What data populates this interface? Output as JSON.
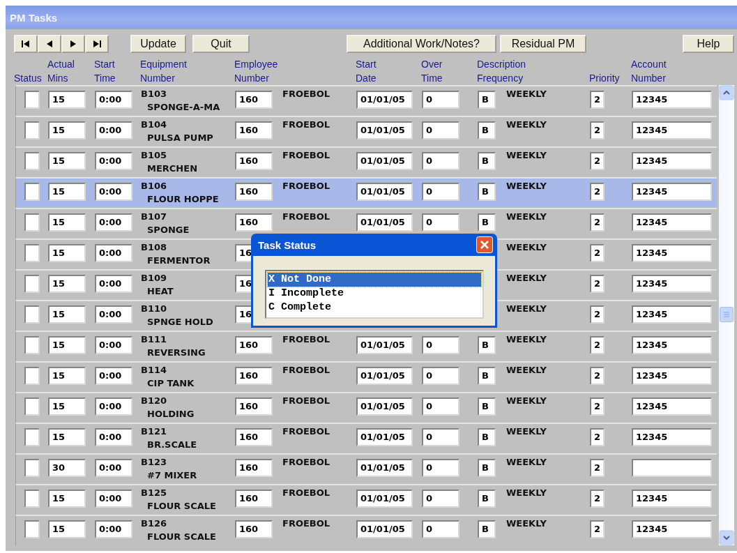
{
  "window": {
    "title": "PM Tasks"
  },
  "toolbar": {
    "nav": [
      {
        "kind": "first"
      },
      {
        "kind": "previous"
      },
      {
        "kind": "next"
      },
      {
        "kind": "last"
      }
    ],
    "actions": [
      "Update",
      "Quit"
    ],
    "notes_buttons": [
      "Additional Work/Notes?",
      "Residual PM"
    ],
    "help": "Help"
  },
  "columns": [
    {
      "lines": [
        "Status"
      ]
    },
    {
      "lines": [
        "Actual",
        "Mins"
      ]
    },
    {
      "lines": [
        "Start",
        "Time"
      ]
    },
    {
      "lines": [
        "Equipment",
        "Number"
      ]
    },
    {
      "lines": [
        "Employee",
        "Number"
      ]
    },
    {
      "lines": [
        "Start",
        "Date"
      ]
    },
    {
      "lines": [
        "Over",
        "Time"
      ]
    },
    {
      "lines": [
        "Description",
        "Frequency"
      ]
    },
    {
      "lines": [
        "Priority"
      ]
    },
    {
      "lines": [
        "Account",
        "Number"
      ]
    }
  ],
  "rows": [
    {
      "selected": false,
      "actual_mins": "15",
      "start_time": "0:00",
      "equipment_number": "B103",
      "equipment_description": "SPONGE-A-MA",
      "employee_number": "160",
      "employee_name": "FROEBOL",
      "start_date": "01/01/05",
      "over_time": "0",
      "frequency_code": "B",
      "frequency": "WEEKLY",
      "priority": "2",
      "account_number": "12345"
    },
    {
      "selected": false,
      "actual_mins": "15",
      "start_time": "0:00",
      "equipment_number": "B104",
      "equipment_description": "PULSA PUMP",
      "employee_number": "160",
      "employee_name": "FROEBOL",
      "start_date": "01/01/05",
      "over_time": "0",
      "frequency_code": "B",
      "frequency": "WEEKLY",
      "priority": "2",
      "account_number": "12345"
    },
    {
      "selected": false,
      "actual_mins": "15",
      "start_time": "0:00",
      "equipment_number": "B105",
      "equipment_description": "MERCHEN",
      "employee_number": "160",
      "employee_name": "FROEBOL",
      "start_date": "01/01/05",
      "over_time": "0",
      "frequency_code": "B",
      "frequency": "WEEKLY",
      "priority": "2",
      "account_number": "12345"
    },
    {
      "selected": true,
      "actual_mins": "15",
      "start_time": "0:00",
      "equipment_number": "B106",
      "equipment_description": "FLOUR HOPPE",
      "employee_number": "160",
      "employee_name": "FROEBOL",
      "start_date": "01/01/05",
      "over_time": "0",
      "frequency_code": "B",
      "frequency": "WEEKLY",
      "priority": "2",
      "account_number": "12345"
    },
    {
      "selected": false,
      "actual_mins": "15",
      "start_time": "0:00",
      "equipment_number": "B107",
      "equipment_description": "SPONGE",
      "employee_number": "160",
      "employee_name": "FROEBOL",
      "start_date": "01/01/05",
      "over_time": "0",
      "frequency_code": "B",
      "frequency": "WEEKLY",
      "priority": "2",
      "account_number": "12345"
    },
    {
      "selected": false,
      "actual_mins": "15",
      "start_time": "0:00",
      "equipment_number": "B108",
      "equipment_description": "FERMENTOR",
      "employee_number": "16",
      "frequency": "WEEKLY",
      "priority": "2",
      "account_number": "12345"
    },
    {
      "selected": false,
      "actual_mins": "15",
      "start_time": "0:00",
      "equipment_number": "B109",
      "equipment_description": "HEAT",
      "employee_number": "16",
      "frequency": "WEEKLY",
      "priority": "2",
      "account_number": "12345"
    },
    {
      "selected": false,
      "actual_mins": "15",
      "start_time": "0:00",
      "equipment_number": "B110",
      "equipment_description": "SPNGE HOLD",
      "employee_number": "16",
      "frequency": "WEEKLY",
      "priority": "2",
      "account_number": "12345"
    },
    {
      "selected": false,
      "actual_mins": "15",
      "start_time": "0:00",
      "equipment_number": "B111",
      "equipment_description": "REVERSING",
      "employee_number": "160",
      "employee_name": "FROEBOL",
      "start_date": "01/01/05",
      "over_time": "0",
      "frequency_code": "B",
      "frequency": "WEEKLY",
      "priority": "2",
      "account_number": "12345"
    },
    {
      "selected": false,
      "actual_mins": "15",
      "start_time": "0:00",
      "equipment_number": "B114",
      "equipment_description": "CIP TANK",
      "employee_number": "160",
      "employee_name": "FROEBOL",
      "start_date": "01/01/05",
      "over_time": "0",
      "frequency_code": "B",
      "frequency": "WEEKLY",
      "priority": "2",
      "account_number": "12345"
    },
    {
      "selected": false,
      "actual_mins": "15",
      "start_time": "0:00",
      "equipment_number": "B120",
      "equipment_description": "HOLDING",
      "employee_number": "160",
      "employee_name": "FROEBOL",
      "start_date": "01/01/05",
      "over_time": "0",
      "frequency_code": "B",
      "frequency": "WEEKLY",
      "priority": "2",
      "account_number": "12345"
    },
    {
      "selected": false,
      "actual_mins": "15",
      "start_time": "0:00",
      "equipment_number": "B121",
      "equipment_description": "BR.SCALE",
      "employee_number": "160",
      "employee_name": "FROEBOL",
      "start_date": "01/01/05",
      "over_time": "0",
      "frequency_code": "B",
      "frequency": "WEEKLY",
      "priority": "2",
      "account_number": "12345"
    },
    {
      "selected": false,
      "actual_mins": "30",
      "start_time": "0:00",
      "equipment_number": "B123",
      "equipment_description": "#7 MIXER",
      "employee_number": "160",
      "employee_name": "FROEBOL",
      "start_date": "01/01/05",
      "over_time": "0",
      "frequency_code": "B",
      "frequency": "WEEKLY",
      "priority": "2"
    },
    {
      "selected": false,
      "actual_mins": "15",
      "start_time": "0:00",
      "equipment_number": "B125",
      "equipment_description": "FLOUR SCALE",
      "employee_number": "160",
      "employee_name": "FROEBOL",
      "start_date": "01/01/05",
      "over_time": "0",
      "frequency_code": "B",
      "frequency": "WEEKLY",
      "priority": "2",
      "account_number": "12345"
    },
    {
      "selected": false,
      "actual_mins": "15",
      "start_time": "0:00",
      "equipment_number": "B126",
      "equipment_description": "FLOUR SCALE",
      "employee_number": "160",
      "employee_name": "FROEBOL",
      "start_date": "01/01/05",
      "over_time": "0",
      "frequency_code": "B",
      "frequency": "WEEKLY",
      "priority": "2",
      "account_number": "12345"
    }
  ],
  "dialog": {
    "title": "Task Status",
    "items": [
      {
        "label": "X Not Done",
        "selected": true
      },
      {
        "label": "I Incomplete",
        "selected": false
      },
      {
        "label": "C Complete",
        "selected": false
      }
    ]
  }
}
